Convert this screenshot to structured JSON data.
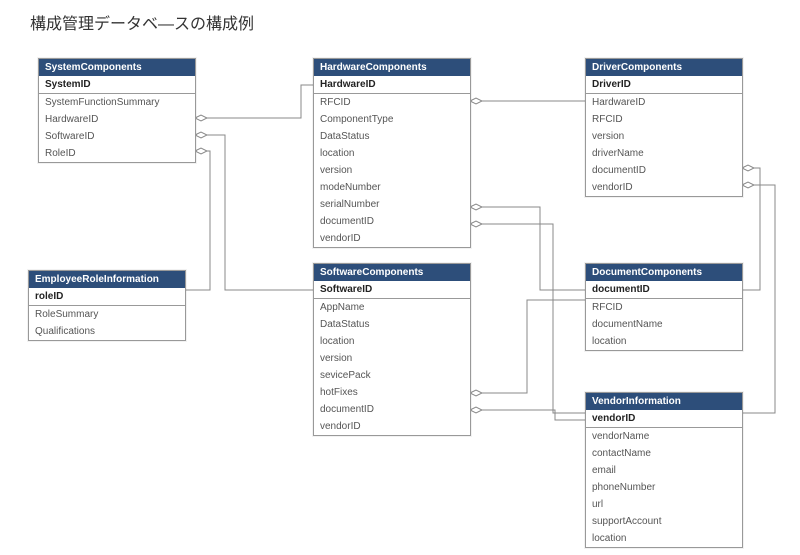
{
  "title": "構成管理データベ―スの構成例",
  "entities": {
    "systemComponents": {
      "name": "SystemComponents",
      "pk": "SystemID",
      "fields": [
        "SystemFunctionSummary",
        "HardwareID",
        "SoftwareID",
        "RoleID"
      ]
    },
    "hardwareComponents": {
      "name": "HardwareComponents",
      "pk": "HardwareID",
      "fields": [
        "RFCID",
        "ComponentType",
        "DataStatus",
        "location",
        "version",
        "modeNumber",
        "serialNumber",
        "documentID",
        "vendorID"
      ]
    },
    "driverComponents": {
      "name": "DriverComponents",
      "pk": "DriverID",
      "fields": [
        "HardwareID",
        "RFCID",
        "version",
        "driverName",
        "documentID",
        "vendorID"
      ]
    },
    "employeeRoleInformation": {
      "name": "EmployeeRoleInformation",
      "pk": "roleID",
      "fields": [
        "RoleSummary",
        "Qualifications"
      ]
    },
    "softwareComponents": {
      "name": "SoftwareComponents",
      "pk": "SoftwareID",
      "fields": [
        "AppName",
        "DataStatus",
        "location",
        "version",
        "sevicePack",
        "hotFixes",
        "documentID",
        "vendorID"
      ]
    },
    "documentComponents": {
      "name": "DocumentComponents",
      "pk": "documentID",
      "fields": [
        "RFCID",
        "documentName",
        "location"
      ]
    },
    "vendorInformation": {
      "name": "VendorInformation",
      "pk": "vendorID",
      "fields": [
        "vendorName",
        "contactName",
        "email",
        "phoneNumber",
        "url",
        "supportAccount",
        "location"
      ]
    }
  }
}
